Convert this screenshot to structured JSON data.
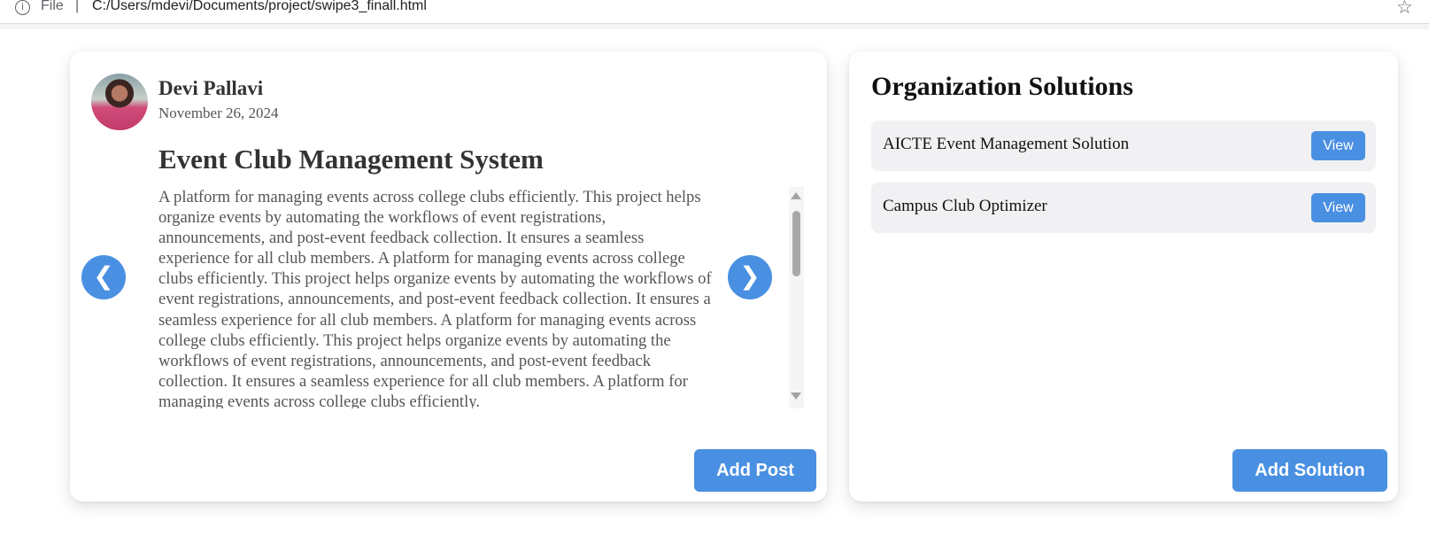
{
  "browser": {
    "info_glyph": "i",
    "file_label": "File",
    "separator": "|",
    "url": "C:/Users/mdevi/Documents/project/swipe3_finall.html",
    "bookmark_glyph": "☆"
  },
  "post": {
    "author": "Devi Pallavi",
    "date": "November 26, 2024",
    "title": "Event Club Management System",
    "content": "A platform for managing events across college clubs efficiently. This project helps organize events by automating the workflows of event registrations, announcements, and post-event feedback collection. It ensures a seamless experience for all club members. A platform for managing events across college clubs efficiently. This project helps organize events by automating the workflows of event registrations, announcements, and post-event feedback collection. It ensures a seamless experience for all club members. A platform for managing events across college clubs efficiently. This project helps organize events by automating the workflows of event registrations, announcements, and post-event feedback collection. It ensures a seamless experience for all club members. A platform for managing events across college clubs efficiently.",
    "prev_glyph": "❮",
    "next_glyph": "❯",
    "add_button": "Add Post"
  },
  "solutions": {
    "title": "Organization Solutions",
    "items": [
      {
        "name": "AICTE Event Management Solution",
        "action": "View"
      },
      {
        "name": "Campus Club Optimizer",
        "action": "View"
      }
    ],
    "add_button": "Add Solution"
  },
  "colors": {
    "accent": "#4a90e2",
    "item_background": "#f1f1f3"
  }
}
